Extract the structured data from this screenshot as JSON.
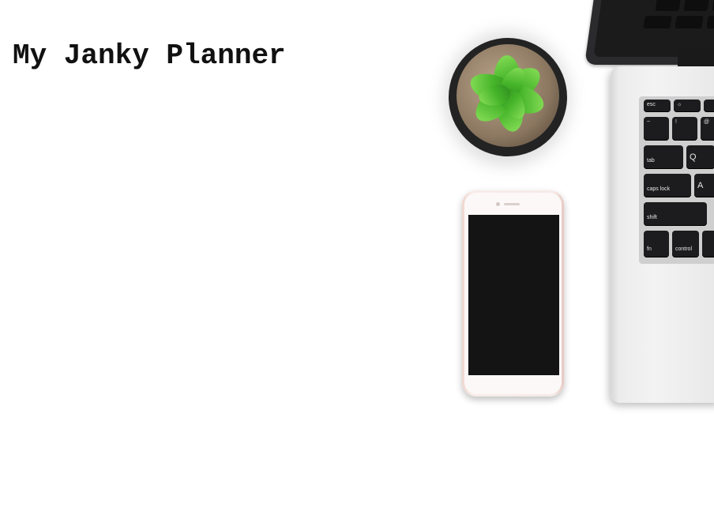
{
  "page": {
    "title": "My Janky Planner"
  },
  "hero": {
    "laptop_keys": {
      "esc": "esc",
      "tab": "tab",
      "q": "Q",
      "caps_lock": "caps lock",
      "a": "A",
      "shift": "shift",
      "fn": "fn",
      "control": "control",
      "tilde": "~",
      "one": "!",
      "two": "@"
    }
  }
}
